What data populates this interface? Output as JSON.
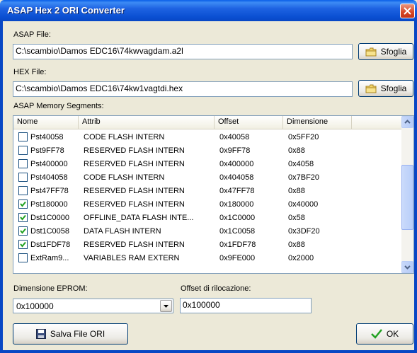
{
  "window": {
    "title": "ASAP Hex 2 ORI Converter"
  },
  "asap_file": {
    "label": "ASAP File:",
    "value": "C:\\scambio\\Damos EDC16\\74kwvagdam.a2l",
    "browse_label": "Sfoglia"
  },
  "hex_file": {
    "label": "HEX File:",
    "value": "C:\\scambio\\Damos EDC16\\74kw1vagtdi.hex",
    "browse_label": "Sfoglia"
  },
  "segments": {
    "label": "ASAP Memory Segments:",
    "columns": [
      "Nome",
      "Attrib",
      "Offset",
      "Dimensione"
    ],
    "rows": [
      {
        "checked": false,
        "nome": "Pst40058",
        "attrib": "CODE FLASH INTERN",
        "offset": "0x40058",
        "dim": "0x5FF20"
      },
      {
        "checked": false,
        "nome": "Pst9FF78",
        "attrib": "RESERVED FLASH INTERN",
        "offset": "0x9FF78",
        "dim": "0x88"
      },
      {
        "checked": false,
        "nome": "Pst400000",
        "attrib": "RESERVED FLASH INTERN",
        "offset": "0x400000",
        "dim": "0x4058"
      },
      {
        "checked": false,
        "nome": "Pst404058",
        "attrib": "CODE FLASH INTERN",
        "offset": "0x404058",
        "dim": "0x7BF20"
      },
      {
        "checked": false,
        "nome": "Pst47FF78",
        "attrib": "RESERVED FLASH INTERN",
        "offset": "0x47FF78",
        "dim": "0x88"
      },
      {
        "checked": true,
        "nome": "Pst180000",
        "attrib": "RESERVED FLASH INTERN",
        "offset": "0x180000",
        "dim": "0x40000"
      },
      {
        "checked": true,
        "nome": "Dst1C0000",
        "attrib": "OFFLINE_DATA FLASH INTE...",
        "offset": "0x1C0000",
        "dim": "0x58"
      },
      {
        "checked": true,
        "nome": "Dst1C0058",
        "attrib": "DATA FLASH INTERN",
        "offset": "0x1C0058",
        "dim": "0x3DF20"
      },
      {
        "checked": true,
        "nome": "Dst1FDF78",
        "attrib": "RESERVED FLASH INTERN",
        "offset": "0x1FDF78",
        "dim": "0x88"
      },
      {
        "checked": false,
        "nome": "ExtRam9...",
        "attrib": "VARIABLES RAM EXTERN",
        "offset": "0x9FE000",
        "dim": "0x2000"
      }
    ]
  },
  "eprom": {
    "label": "Dimensione EPROM:",
    "value": "0x100000"
  },
  "reloc": {
    "label": "Offset di rilocazione:",
    "value": "0x100000"
  },
  "buttons": {
    "save": "Salva File ORI",
    "ok": "OK"
  },
  "colors": {
    "titlebar": "#0A4FD2",
    "face": "#ECE9D8",
    "check": "#21A121"
  }
}
